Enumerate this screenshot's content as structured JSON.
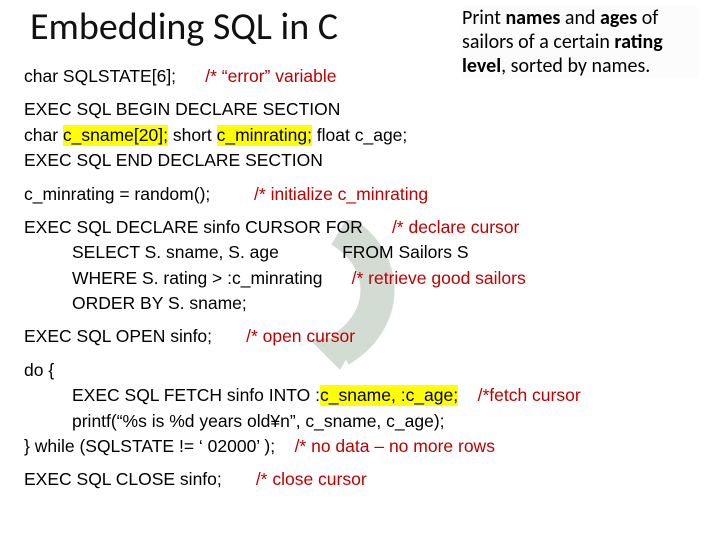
{
  "title": "Embedding SQL in C",
  "callout": {
    "l1a": "Print ",
    "l1b": "names",
    "l1c": " and ",
    "l1d": "ages",
    "l1e": " of",
    "l2a": "sailors of a certain ",
    "l2b": "rating",
    "l3a": "level",
    "l3b": ", sorted by names."
  },
  "l1a": "char SQLSTATE[6];",
  "l1b": "/* “error” variable",
  "l2": "EXEC SQL BEGIN DECLARE SECTION",
  "l3a": "char   ",
  "l3b": "c_sname[20];",
  "l3c": "    short   ",
  "l3d": "c_minrating;",
  "l3e": "    float   c_age;",
  "l4": "EXEC SQL END DECLARE SECTION",
  "l5a": "c_minrating = random();",
  "l5b": "/* initialize c_minrating",
  "l6a": "EXEC SQL DECLARE sinfo CURSOR FOR",
  "l6b": "/* declare cursor",
  "l7a": "SELECT S. sname, S. age",
  "l7b": "FROM Sailors S",
  "l8a": "WHERE S. rating > :c_minrating",
  "l8b": "/* retrieve good sailors",
  "l9": "ORDER BY S. sname;",
  "l10a": "EXEC SQL OPEN sinfo;",
  "l10b": "/* open cursor",
  "l11": "do {",
  "l12a": "EXEC SQL FETCH sinfo INTO :",
  "l12b": "c_sname, :c_age;",
  "l12c": "/*fetch cursor",
  "l13": "printf(“%s is %d years old¥n”, c_sname, c_age);",
  "l14a": "} while (SQLSTATE != ‘ 02000’ );",
  "l14b": "/* no data – no more rows",
  "l15a": "EXEC SQL CLOSE sinfo;",
  "l15b": "/* close cursor"
}
